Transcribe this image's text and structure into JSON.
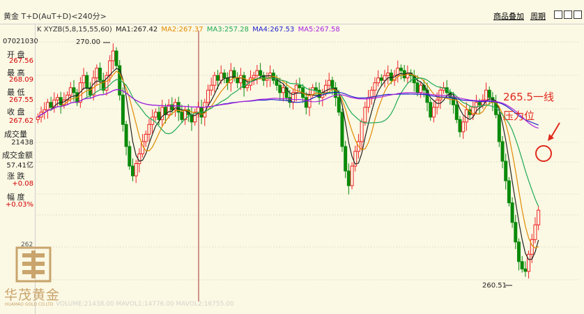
{
  "symbol_bar": {
    "symbol": "黄金 T+D(AuT+D)<240分>",
    "overlay_button": "商品叠加",
    "period_button": "周期"
  },
  "info_panel": {
    "code": "07021030",
    "rows": [
      {
        "label": "开 盘",
        "value": "267.56"
      },
      {
        "label": "最 高",
        "value": "268.09"
      },
      {
        "label": "最 低",
        "value": "267.55"
      },
      {
        "label": "收 盘",
        "value": "267.62"
      },
      {
        "label": "成交量",
        "value": "21438"
      },
      {
        "label": "成交金额",
        "value": "57.41亿"
      },
      {
        "label": "涨 跌",
        "value": "+0.08"
      },
      {
        "label": "幅 度",
        "value": "+0.03%"
      }
    ]
  },
  "legend": {
    "prefix": "K  XYZB(5,8,15,55,60)",
    "ma1": "MA1:267.42",
    "ma2": "MA2:267.37",
    "ma3": "MA3:257.28",
    "ma4": "MA4:267.53",
    "ma5": "MA5:267.58"
  },
  "colors": {
    "up": "#ee2222",
    "down": "#0a8a0a",
    "ma1": "#222222",
    "ma2": "#e08a00",
    "ma3": "#1faa55",
    "ma4": "#2222cc",
    "ma5": "#aa22dd",
    "annotation": "#e0291c"
  },
  "annotation": {
    "line1": "265.5一线",
    "line2": "压力位"
  },
  "brand": {
    "cn": "华茂黄金",
    "en": "HUAMAO GOLD CO.LTD"
  },
  "footer": "VOLUME:21438.00  MAVOL1:14776.00  MAVOL2:16755.00",
  "chart_data": {
    "type": "candlestick",
    "title": "黄金 T+D(AuT+D)<240分>",
    "high_label": "270.00",
    "low_label": "260.51",
    "y_tick_label": "262",
    "ylim": [
      260.3,
      270.5
    ],
    "series": [
      {
        "name": "MA1",
        "value": 267.42
      },
      {
        "name": "MA2",
        "value": 267.37
      },
      {
        "name": "MA3",
        "value": 257.28
      },
      {
        "name": "MA4",
        "value": 267.53
      },
      {
        "name": "MA5",
        "value": 267.58
      }
    ],
    "closes": [
      267.2,
      267.4,
      267.5,
      267.8,
      267.6,
      267.9,
      268.0,
      267.7,
      267.9,
      268.1,
      268.4,
      268.2,
      267.8,
      268.6,
      268.9,
      268.4,
      268.1,
      268.8,
      269.2,
      268.7,
      268.3,
      268.9,
      269.5,
      269.9,
      269.3,
      268.1,
      266.9,
      266.0,
      265.2,
      264.8,
      265.3,
      265.7,
      266.2,
      266.5,
      266.9,
      267.2,
      267.4,
      267.1,
      267.6,
      267.3,
      267.7,
      267.5,
      267.8,
      267.4,
      267.1,
      267.5,
      267.3,
      267.0,
      267.4,
      267.6,
      267.2,
      267.8,
      268.3,
      268.5,
      268.9,
      268.7,
      269.0,
      268.8,
      268.6,
      269.1,
      268.8,
      268.6,
      268.9,
      268.4,
      268.5,
      268.8,
      268.9,
      269.1,
      268.9,
      268.7,
      268.8,
      269.0,
      268.7,
      268.5,
      268.2,
      268.4,
      268.0,
      267.8,
      268.2,
      268.5,
      268.4,
      268.0,
      267.6,
      268.1,
      268.4,
      268.3,
      268.0,
      268.2,
      268.5,
      268.7,
      268.4,
      268.0,
      267.4,
      266.0,
      265.0,
      264.4,
      265.2,
      265.8,
      266.2,
      267.0,
      267.6,
      268.0,
      268.3,
      268.6,
      268.8,
      268.7,
      268.9,
      269.0,
      268.7,
      268.9,
      269.2,
      269.1,
      268.8,
      269.0,
      268.9,
      268.6,
      268.2,
      268.5,
      268.3,
      267.8,
      267.2,
      267.6,
      267.9,
      268.3,
      268.4,
      268.2,
      268.0,
      267.7,
      267.1,
      266.6,
      267.0,
      267.5,
      267.3,
      267.6,
      267.8,
      267.7,
      267.9,
      268.3,
      268.0,
      267.8,
      267.3,
      266.2,
      265.4,
      264.6,
      263.7,
      262.9,
      262.1,
      261.3,
      261.0,
      260.9,
      261.6,
      262.2,
      262.8,
      263.4
    ]
  }
}
